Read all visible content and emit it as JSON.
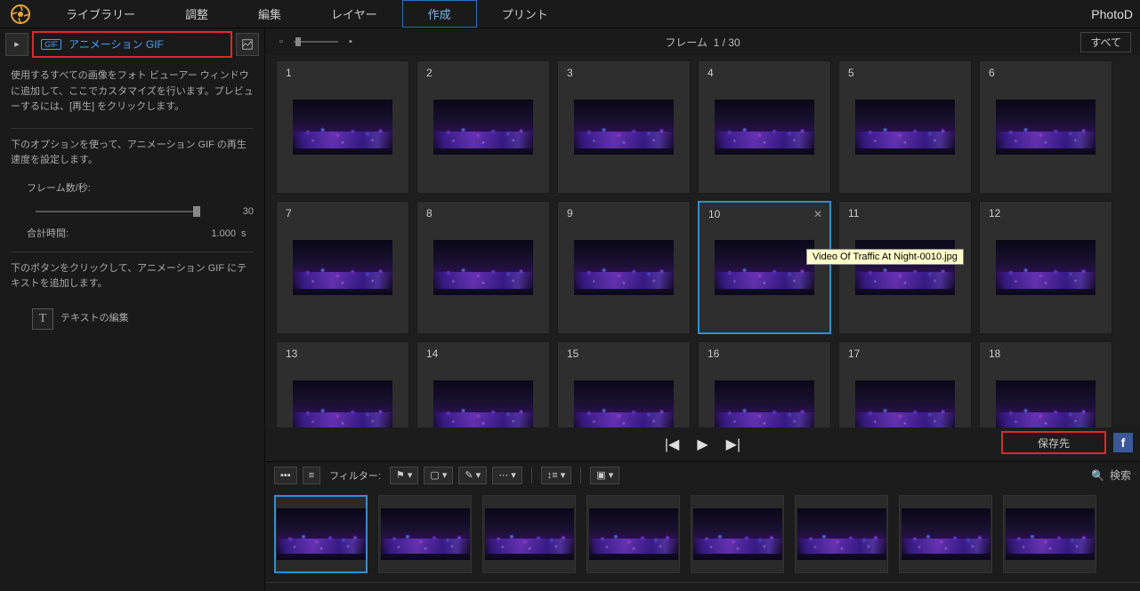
{
  "brand": "PhotoD",
  "nav": {
    "library": "ライブラリー",
    "adjust": "調整",
    "edit": "編集",
    "layer": "レイヤー",
    "create": "作成",
    "print": "プリント"
  },
  "mode": {
    "label": "アニメーション GIF",
    "badge": "GIF"
  },
  "sidebar": {
    "help1": "使用するすべての画像をフォト ビューアー ウィンドウに追加して、ここでカスタマイズを行います。プレビューするには、[再生] をクリックします。",
    "help2": "下のオプションを使って、アニメーション GIF の再生速度を設定します。",
    "fps_label": "フレーム数/秒:",
    "fps_value": "30",
    "total_label": "合計時間:",
    "total_value": "1.000",
    "total_unit": "s",
    "help3": "下のボタンをクリックして、アニメーション GIF にテキストを追加します。",
    "text_edit": "テキストの編集"
  },
  "frames": {
    "counter_prefix": "フレーム",
    "counter_value": "1 / 30",
    "all_btn": "すべて",
    "items": [
      {
        "n": "1"
      },
      {
        "n": "2"
      },
      {
        "n": "3"
      },
      {
        "n": "4"
      },
      {
        "n": "5"
      },
      {
        "n": "6"
      },
      {
        "n": "7"
      },
      {
        "n": "8"
      },
      {
        "n": "9"
      },
      {
        "n": "10",
        "selected": true
      },
      {
        "n": "11"
      },
      {
        "n": "12"
      },
      {
        "n": "13"
      },
      {
        "n": "14"
      },
      {
        "n": "15"
      },
      {
        "n": "16"
      },
      {
        "n": "17"
      },
      {
        "n": "18"
      }
    ],
    "tooltip": "Video Of Traffic At Night-0010.jpg"
  },
  "playback": {
    "save_btn": "保存先"
  },
  "filter": {
    "label": "フィルター:",
    "search": "検索"
  },
  "filmstrip": {
    "count": 8,
    "selected_index": 0
  }
}
